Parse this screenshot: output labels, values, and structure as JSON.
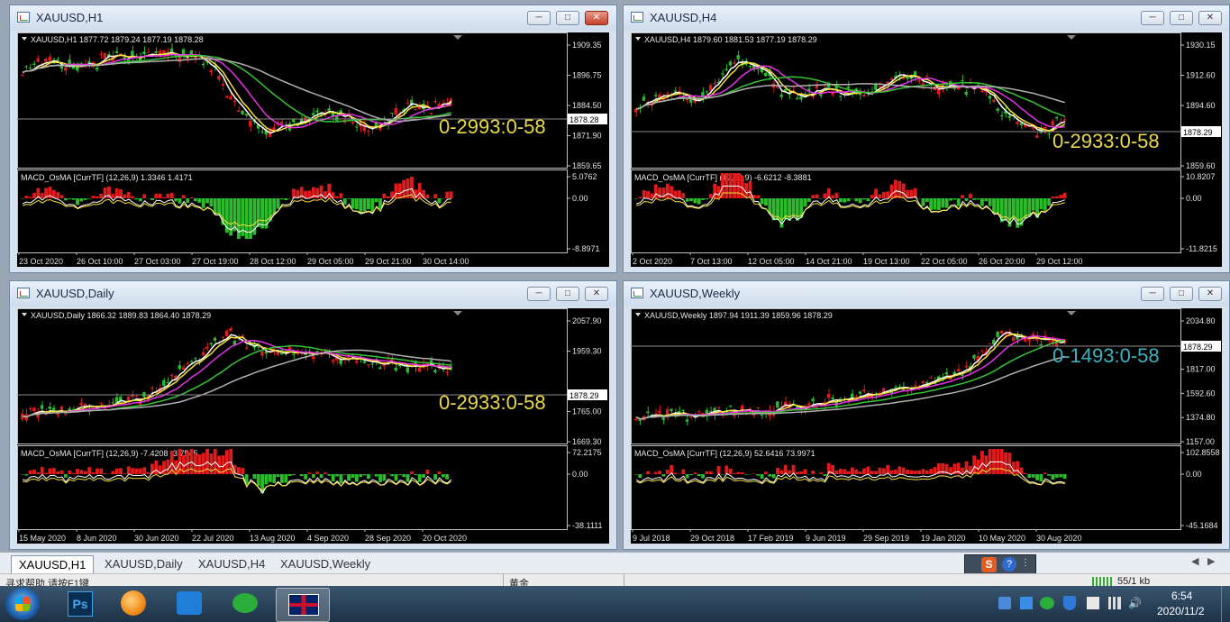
{
  "windows": [
    {
      "title": "XAUUSD,H1",
      "header": "XAUUSD,H1  1877.72 1879.24 1877.19 1878.28",
      "price_scale": [
        "1909.35",
        "1896.75",
        "1884.50",
        "1871.90",
        "1859.65"
      ],
      "current_price": "1878.28",
      "overlay_text": "0-2993:0-58",
      "macd_header": "MACD_OsMA [CurrTF] (12,26,9) 1.3346 1.4171",
      "macd_scale": [
        "5.0762",
        "0.00",
        "-8.8971"
      ],
      "time_labels": [
        "23 Oct 2020",
        "26 Oct 10:00",
        "27 Oct 03:00",
        "27 Oct 19:00",
        "28 Oct 12:00",
        "29 Oct 05:00",
        "29 Oct 21:00",
        "30 Oct 14:00"
      ]
    },
    {
      "title": "XAUUSD,H4",
      "header": "XAUUSD,H4  1879.60 1881.53 1877.19 1878.29",
      "price_scale": [
        "1930.15",
        "1912.60",
        "1894.60",
        "1878.29",
        "1859.60"
      ],
      "current_price": "1878.29",
      "overlay_text": "0-2933:0-58",
      "macd_header": "MACD_OsMA [CurrTF] (12,26,9) -6.6212 -8.3881",
      "macd_scale": [
        "10.8207",
        "0.00",
        "-11.8215"
      ],
      "time_labels": [
        "2 Oct 2020",
        "7 Oct 13:00",
        "12 Oct 05:00",
        "14 Oct 21:00",
        "19 Oct 13:00",
        "22 Oct 05:00",
        "26 Oct 20:00",
        "29 Oct 12:00"
      ]
    },
    {
      "title": "XAUUSD,Daily",
      "header": "XAUUSD,Daily  1866.32 1889.83 1864.40 1878.29",
      "price_scale": [
        "2057.90",
        "1959.30",
        "1878.29",
        "1765.00",
        "1669.30"
      ],
      "current_price": "1878.29",
      "overlay_text": "0-2933:0-58",
      "macd_header": "MACD_OsMA [CurrTF] (12,26,9) -7.4208 -3.7545",
      "macd_scale": [
        "72.2175",
        "0.00",
        "-38.1111"
      ],
      "time_labels": [
        "15 May 2020",
        "8 Jun 2020",
        "30 Jun 2020",
        "22 Jul 2020",
        "13 Aug 2020",
        "4 Sep 2020",
        "28 Sep 2020",
        "20 Oct 2020"
      ]
    },
    {
      "title": "XAUUSD,Weekly",
      "header": "XAUUSD,Weekly  1897.94 1911.39 1859.96 1878.29",
      "price_scale": [
        "2034.80",
        "1878.29",
        "1817.00",
        "1592.60",
        "1374.80",
        "1157.00"
      ],
      "current_price": "1878.29",
      "overlay_text": "0-1493:0-58",
      "macd_header": "MACD_OsMA [CurrTF] (12,26,9) 52.6416 73.9971",
      "macd_scale": [
        "102.8558",
        "0.00",
        "-45.1684"
      ],
      "time_labels": [
        "9 Jul 2018",
        "29 Oct 2018",
        "17 Feb 2019",
        "9 Jun 2019",
        "29 Sep 2019",
        "19 Jan 2020",
        "10 May 2020",
        "30 Aug 2020"
      ]
    }
  ],
  "tabs": [
    "XAUUSD,H1",
    "XAUUSD,Daily",
    "XAUUSD,H4",
    "XAUUSD,Weekly"
  ],
  "statusbar": {
    "help": "寻求帮助,请按F1键",
    "profile": "黄金",
    "traffic": "55/1 kb"
  },
  "taskbar": {
    "clock_time": "6:54",
    "clock_date": "2020/11/2",
    "ps_label": "Ps"
  },
  "colors": {
    "bull": "#2dbb2d",
    "bear": "#e01b1b",
    "ma_white": "#ffffff",
    "ma_yellow": "#f7e03a",
    "ma_magenta": "#e433e4",
    "ma_green": "#35c435",
    "ma_gray": "#b0b0b0",
    "overlay": "#e8d84a",
    "overlay_weekly": "#3fb0c0"
  }
}
